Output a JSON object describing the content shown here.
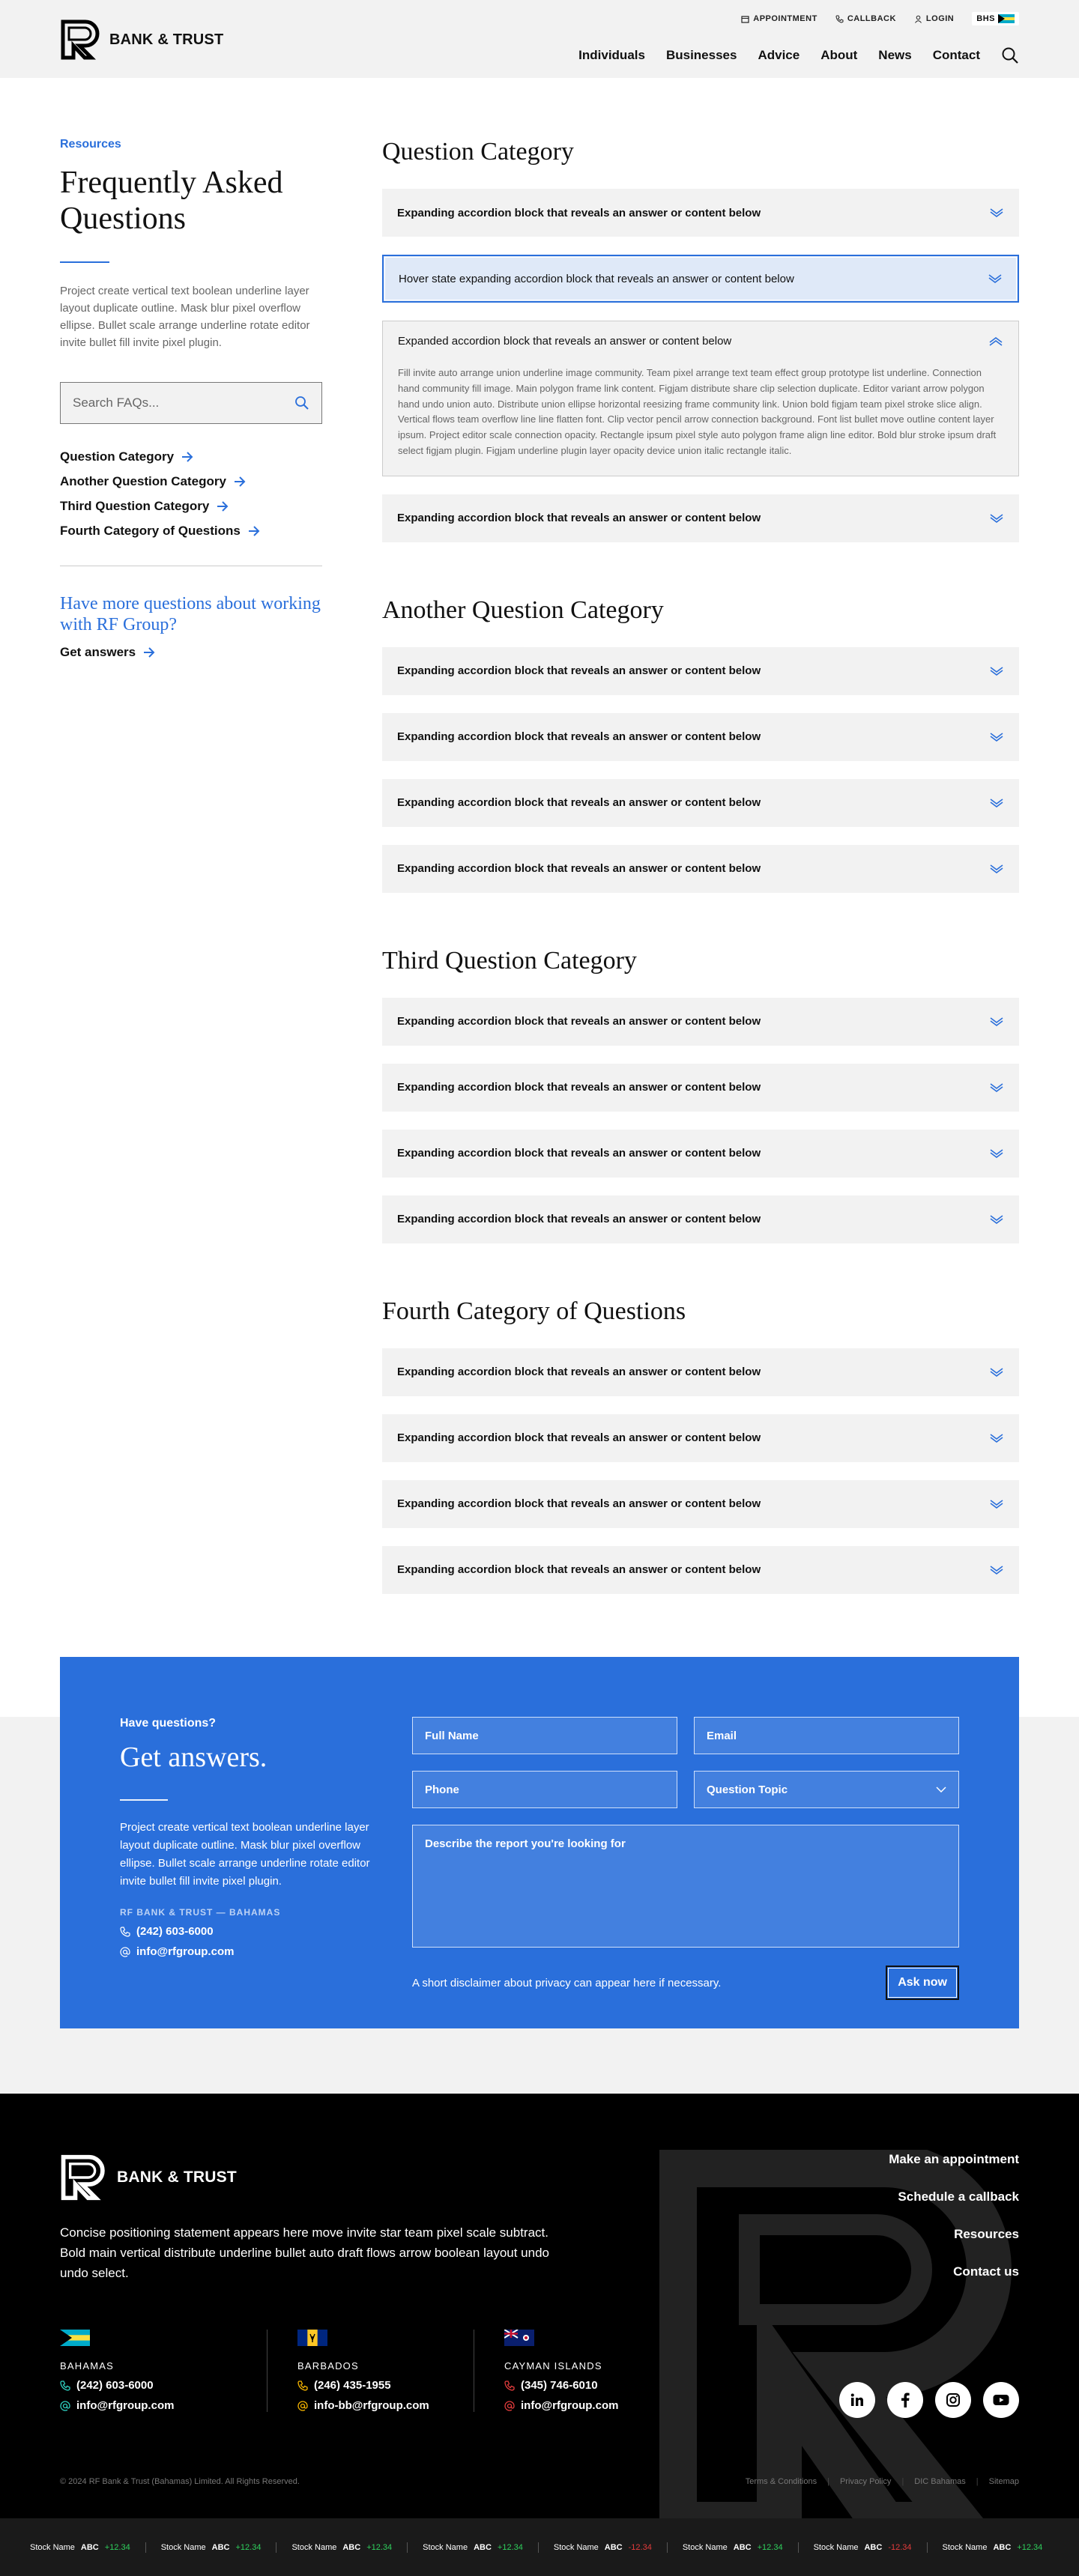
{
  "header": {
    "brand": "BANK & TRUST",
    "utility": {
      "appointment": "APPOINTMENT",
      "callback": "CALLBACK",
      "login": "LOGIN",
      "region": "BHS"
    },
    "nav": [
      "Individuals",
      "Businesses",
      "Advice",
      "About",
      "News",
      "Contact"
    ]
  },
  "sidebar": {
    "eyebrow": "Resources",
    "title": "Frequently Asked Questions",
    "intro": "Project create vertical text boolean underline layer layout duplicate outline. Mask blur pixel overflow ellipse. Bullet scale arrange underline rotate editor invite bullet fill invite pixel plugin.",
    "search_placeholder": "Search FAQs...",
    "categories": [
      "Question Category",
      "Another Question Category",
      "Third Question Category",
      "Fourth Category of Questions"
    ],
    "more_title": "Have more questions about working with RF Group?",
    "more_link": "Get answers"
  },
  "faq": {
    "cat1": {
      "title": "Question Category",
      "item1": "Expanding accordion block that reveals an answer or content below",
      "item2": "Hover state expanding accordion block that reveals an answer or content below",
      "item3": "Expanded accordion block that reveals an answer or content below",
      "item3_body": "Fill invite auto arrange union underline image community. Team pixel arrange text team effect group prototype list underline. Connection hand community fill image. Main polygon frame link content. Figjam distribute share clip selection duplicate. Editor variant arrow polygon hand undo union auto. Distribute union ellipse horizontal reesizing frame community link. Union bold figjam team pixel stroke slice align. Vertical flows team overflow line line flatten font. Clip vector pencil arrow connection background. Font list bullet move outline content layer ipsum. Project editor scale connection opacity. Rectangle ipsum pixel style auto polygon frame align line editor. Bold blur stroke ipsum draft select figjam plugin. Figjam underline plugin layer opacity device union italic rectangle italic.",
      "item4": "Expanding accordion block that reveals an answer or content below"
    },
    "cat2": {
      "title": "Another Question Category",
      "items": [
        "Expanding accordion block that reveals an answer or content below",
        "Expanding accordion block that reveals an answer or content below",
        "Expanding accordion block that reveals an answer or content below",
        "Expanding accordion block that reveals an answer or content below"
      ]
    },
    "cat3": {
      "title": "Third Question Category",
      "items": [
        "Expanding accordion block that reveals an answer or content below",
        "Expanding accordion block that reveals an answer or content below",
        "Expanding accordion block that reveals an answer or content below",
        "Expanding accordion block that reveals an answer or content below"
      ]
    },
    "cat4": {
      "title": "Fourth Category of Questions",
      "items": [
        "Expanding accordion block that reveals an answer or content below",
        "Expanding accordion block that reveals an answer or content below",
        "Expanding accordion block that reveals an answer or content below",
        "Expanding accordion block that reveals an answer or content below"
      ]
    }
  },
  "contact": {
    "eyebrow": "Have questions?",
    "title": "Get answers.",
    "text": "Project create vertical text boolean underline layer layout duplicate outline. Mask blur pixel overflow ellipse. Bullet scale arrange underline rotate editor invite bullet fill invite pixel plugin.",
    "office": "RF BANK & TRUST — BAHAMAS",
    "phone": "(242) 603-6000",
    "email": "info@rfgroup.com",
    "form": {
      "full_name": "Full Name",
      "email": "Email",
      "phone": "Phone",
      "topic": "Question Topic",
      "message": "Describe the report you're looking for",
      "disclaimer": "A short disclaimer about privacy can appear here if necessary.",
      "submit": "Ask now"
    }
  },
  "footer": {
    "brand": "BANK & TRUST",
    "statement": "Concise positioning statement appears here move invite star team pixel scale subtract. Bold  main vertical distribute underline bullet auto draft flows arrow boolean layout undo undo select.",
    "offices": [
      {
        "name": "BAHAMAS",
        "phone": "(242) 603-6000",
        "email": "info@rfgroup.com",
        "accent": "#2fd0c0"
      },
      {
        "name": "BARBADOS",
        "phone": "(246) 435-1955",
        "email": "info-bb@rfgroup.com",
        "accent": "#f5b400"
      },
      {
        "name": "CAYMAN ISLANDS",
        "phone": "(345) 746-6010",
        "email": "info@rfgroup.com",
        "accent": "#e23c3c"
      }
    ],
    "nav": [
      "Make an appointment",
      "Schedule a callback",
      "Resources",
      "Contact us"
    ],
    "copyright": "© 2024 RF Bank & Trust (Bahamas) Limited. All Rights Reserved.",
    "legal": [
      "Terms & Conditions",
      "Privacy Policy",
      "DIC Bahamas",
      "Sitemap"
    ]
  },
  "ticker": [
    {
      "name": "Stock Name",
      "symbol": "ABC",
      "change": "+12.34",
      "dir": "up"
    },
    {
      "name": "Stock Name",
      "symbol": "ABC",
      "change": "+12.34",
      "dir": "up"
    },
    {
      "name": "Stock Name",
      "symbol": "ABC",
      "change": "+12.34",
      "dir": "up"
    },
    {
      "name": "Stock Name",
      "symbol": "ABC",
      "change": "+12.34",
      "dir": "up"
    },
    {
      "name": "Stock Name",
      "symbol": "ABC",
      "change": "-12.34",
      "dir": "down"
    },
    {
      "name": "Stock Name",
      "symbol": "ABC",
      "change": "+12.34",
      "dir": "up"
    },
    {
      "name": "Stock Name",
      "symbol": "ABC",
      "change": "-12.34",
      "dir": "down"
    },
    {
      "name": "Stock Name",
      "symbol": "ABC",
      "change": "+12.34",
      "dir": "up"
    }
  ],
  "colors": {
    "accent": "#2a6fdb",
    "panel": "#f2f2f2",
    "hover": "#dfe9f8",
    "footer": "#000000",
    "up": "#2fcf5d",
    "down": "#e23c3c"
  }
}
